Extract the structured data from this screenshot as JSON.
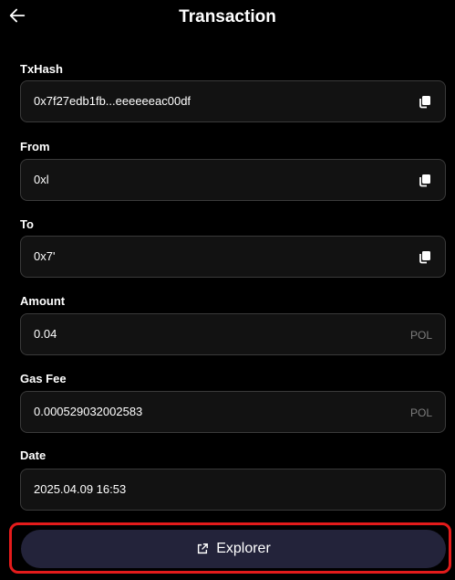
{
  "header": {
    "title": "Transaction",
    "back_icon": "arrow-left-icon"
  },
  "fields": {
    "txhash": {
      "label": "TxHash",
      "value": "0x7f27edb1fb...eeeeeeac00df",
      "icon": "copy-icon"
    },
    "from": {
      "label": "From",
      "value": "0xl",
      "icon": "copy-icon"
    },
    "to": {
      "label": "To",
      "value": "0x7'",
      "icon": "copy-icon"
    },
    "amount": {
      "label": "Amount",
      "value": "0.04",
      "unit": "POL"
    },
    "gas_fee": {
      "label": "Gas Fee",
      "value": "0.000529032002583",
      "unit": "POL"
    },
    "date": {
      "label": "Date",
      "value": "2025.04.09 16:53"
    }
  },
  "explorer": {
    "label": "Explorer",
    "icon": "external-link-icon"
  },
  "colors": {
    "background": "#000000",
    "field_bg": "#121212",
    "field_border": "#3a3a3a",
    "button_bg": "#23233a",
    "highlight": "#e41b1b",
    "unit_text": "#7d7d7d"
  }
}
